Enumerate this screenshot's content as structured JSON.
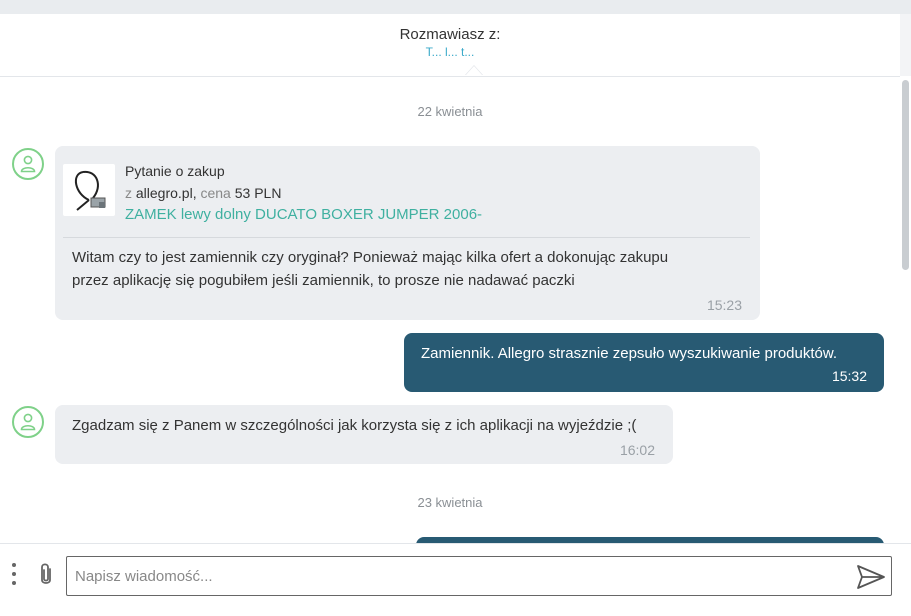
{
  "header": {
    "label": "Rozmawiasz z:",
    "username": "T... l... t..."
  },
  "dates": [
    "22 kwietnia",
    "23 kwietnia"
  ],
  "messages": [
    {
      "direction": "incoming",
      "product": {
        "title": "Pytanie o zakup",
        "from_prefix": "z",
        "source": "allegro.pl,",
        "price_prefix": "cena",
        "price": "53 PLN",
        "name": "ZAMEK lewy dolny DUCATO BOXER JUMPER 2006-"
      },
      "text_line1": "Witam czy to jest zamiennik czy oryginał? Ponieważ mając kilka ofert a dokonując zakupu",
      "text_line2": "przez aplikację się pogubiłem jeśli zamiennik, to prosze nie nadawać paczki",
      "time": "15:23"
    },
    {
      "direction": "outgoing",
      "text": "Zamiennik. Allegro strasznie zepsuło wyszukiwanie produktów.",
      "time": "15:32"
    },
    {
      "direction": "incoming",
      "text": "Zgadzam się z Panem w szczególności jak korzysta się z ich aplikacji na wyjeździe ;(",
      "time": "16:02"
    }
  ],
  "composer": {
    "placeholder": "Napisz wiadomość..."
  },
  "icons": {
    "avatar": "user-icon",
    "menu": "vertical-dots-icon",
    "attach": "paperclip-icon",
    "send": "send-icon"
  },
  "colors": {
    "outgoing_bubble": "#285a73",
    "incoming_bubble": "#eceef1",
    "link": "#3fb0a0",
    "avatar_ring": "#7fd189"
  }
}
